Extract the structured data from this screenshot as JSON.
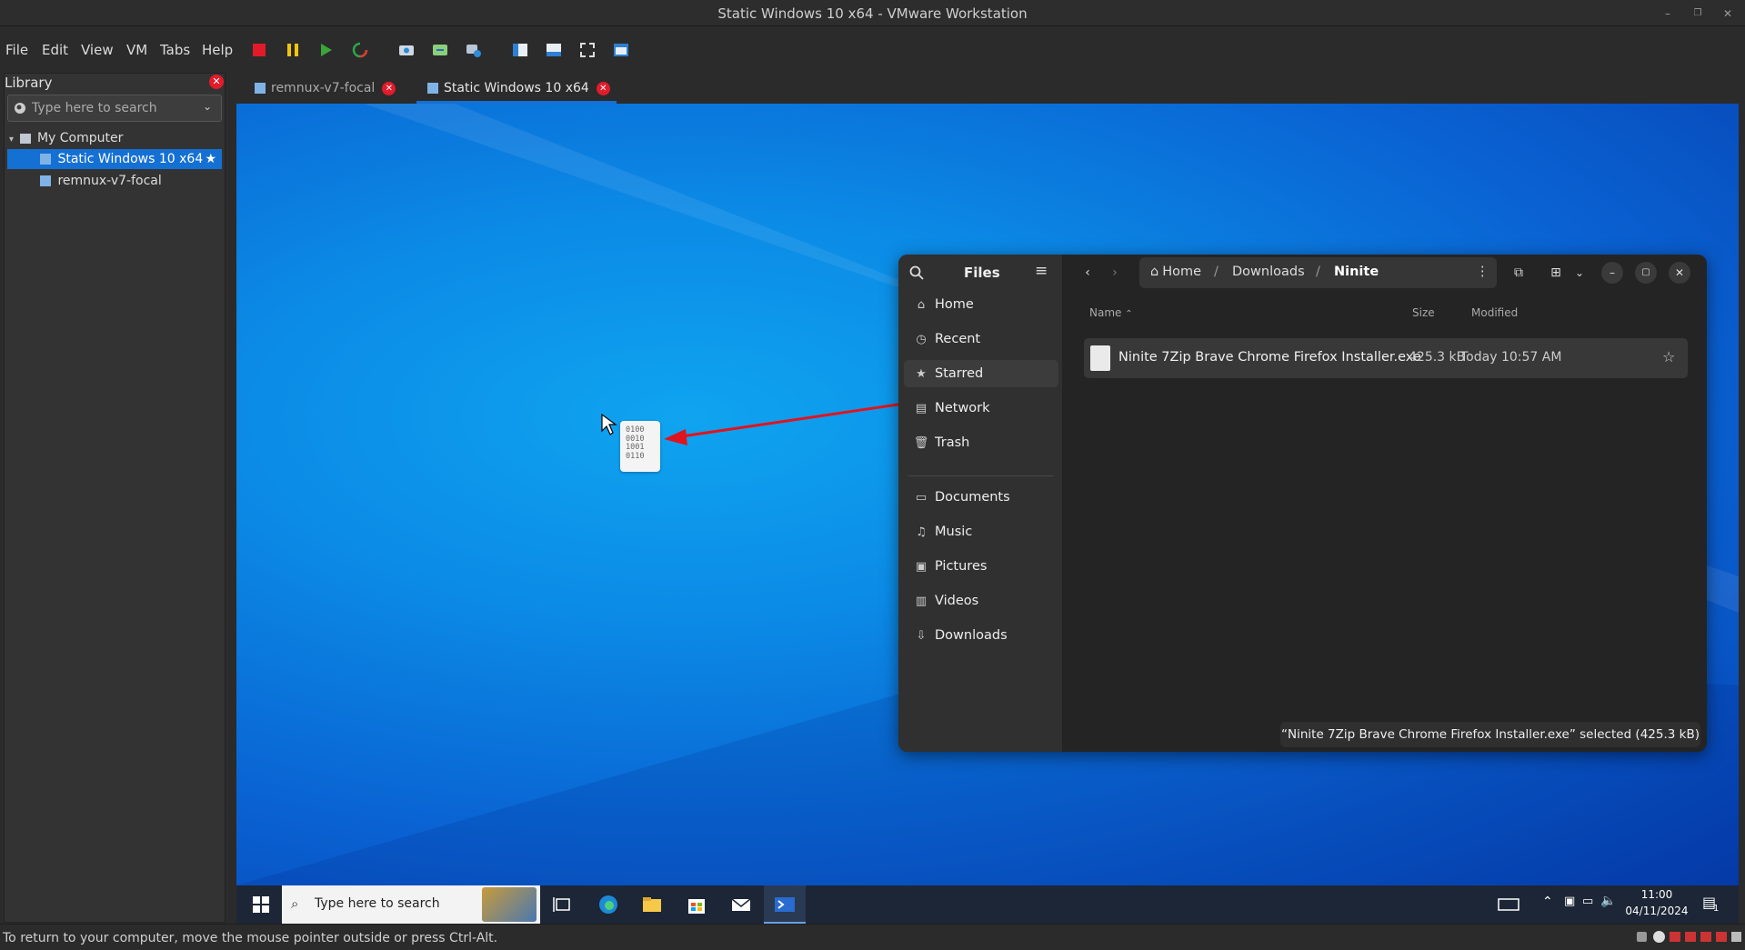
{
  "window": {
    "title": "Static Windows 10 x64 - VMware Workstation"
  },
  "menu": [
    "File",
    "Edit",
    "View",
    "VM",
    "Tabs",
    "Help"
  ],
  "library": {
    "title": "Library",
    "search_placeholder": "Type here to search",
    "tree": {
      "root": "My Computer",
      "items": [
        "Static Windows 10 x64",
        "remnux-v7-focal"
      ]
    }
  },
  "tabs": [
    {
      "label": "remnux-v7-focal",
      "active": false
    },
    {
      "label": "Static Windows 10 x64",
      "active": true
    }
  ],
  "files": {
    "app_title": "Files",
    "sidebar": [
      "Home",
      "Recent",
      "Starred",
      "Network",
      "Trash"
    ],
    "sidebar_places": [
      "Documents",
      "Music",
      "Pictures",
      "Videos",
      "Downloads"
    ],
    "breadcrumb": [
      "Home",
      "Downloads",
      "Ninite"
    ],
    "columns": {
      "name": "Name",
      "size": "Size",
      "modified": "Modified"
    },
    "rows": [
      {
        "name": "Ninite 7Zip Brave Chrome Firefox Installer.exe",
        "size": "425.3 kB",
        "modified": "Today 10:57 AM"
      }
    ],
    "status": "“Ninite 7Zip Brave Chrome Firefox Installer.exe” selected  (425.3 kB)"
  },
  "drag_icon_text": [
    "0100",
    "0010",
    "1001",
    "0110"
  ],
  "taskbar": {
    "search_placeholder": "Type here to search",
    "time": "11:00",
    "date": "04/11/2024",
    "notification_count": "1"
  },
  "statusbar": {
    "hint": "To return to your computer, move the mouse pointer outside or press Ctrl-Alt."
  },
  "colors": {
    "accent": "#1570d4",
    "close_red": "#e21b2a",
    "arrow": "#e0141e"
  }
}
